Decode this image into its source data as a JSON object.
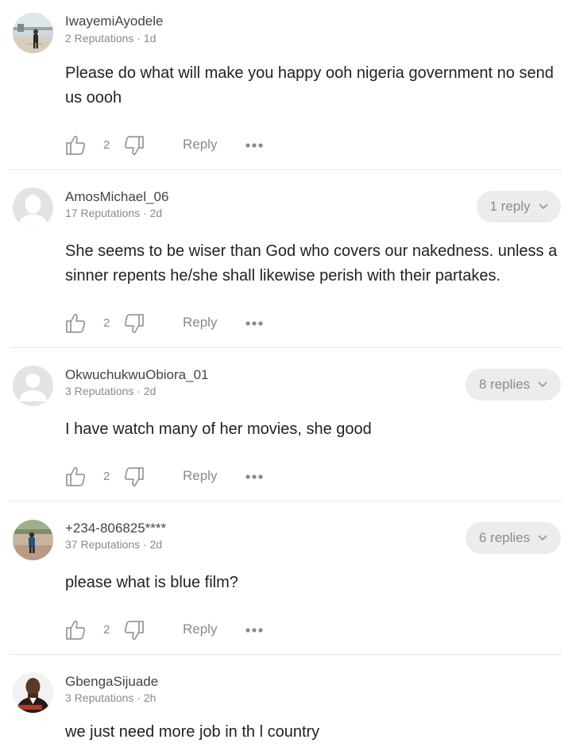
{
  "comments": [
    {
      "username": "IwayemiAyodele",
      "meta": "2 Reputations · 1d",
      "text": "Please do what will make you happy ooh nigeria government no send us oooh",
      "likes": "2",
      "reply_label": "Reply",
      "replies_label": "",
      "avatar": "photo-avatar-person-outdoors"
    },
    {
      "username": "AmosMichael_06",
      "meta": "17 Reputations · 2d",
      "text": "She seems to be wiser than God who covers our nakedness. unless a sinner repents he/she shall likewise perish with their partakes.",
      "likes": "2",
      "reply_label": "Reply",
      "replies_label": "1 reply",
      "avatar": "default-avatar"
    },
    {
      "username": "OkwuchukwuObiora_01",
      "meta": "3 Reputations · 2d",
      "text": "I have watch many of her movies, she good",
      "likes": "2",
      "reply_label": "Reply",
      "replies_label": "8 replies",
      "avatar": "default-avatar"
    },
    {
      "username": "+234-806825****",
      "meta": "37 Reputations · 2d",
      "text": "please what is blue film?",
      "likes": "2",
      "reply_label": "Reply",
      "replies_label": "6 replies",
      "avatar": "photo-avatar-person-field"
    },
    {
      "username": "GbengaSijuade",
      "meta": "3 Reputations · 2h",
      "text": "we just need more job in th l country",
      "likes": "",
      "reply_label": "",
      "replies_label": "",
      "avatar": "photo-avatar-portrait"
    }
  ],
  "icons": {
    "like": "thumbs-up-icon",
    "dislike": "thumbs-down-icon",
    "more": "more-dots-icon",
    "chevron": "chevron-down-icon"
  },
  "colors": {
    "text": "#222222",
    "muted": "#8a8a8a",
    "pill_bg": "#ececec",
    "divider": "#e8e8e8"
  }
}
